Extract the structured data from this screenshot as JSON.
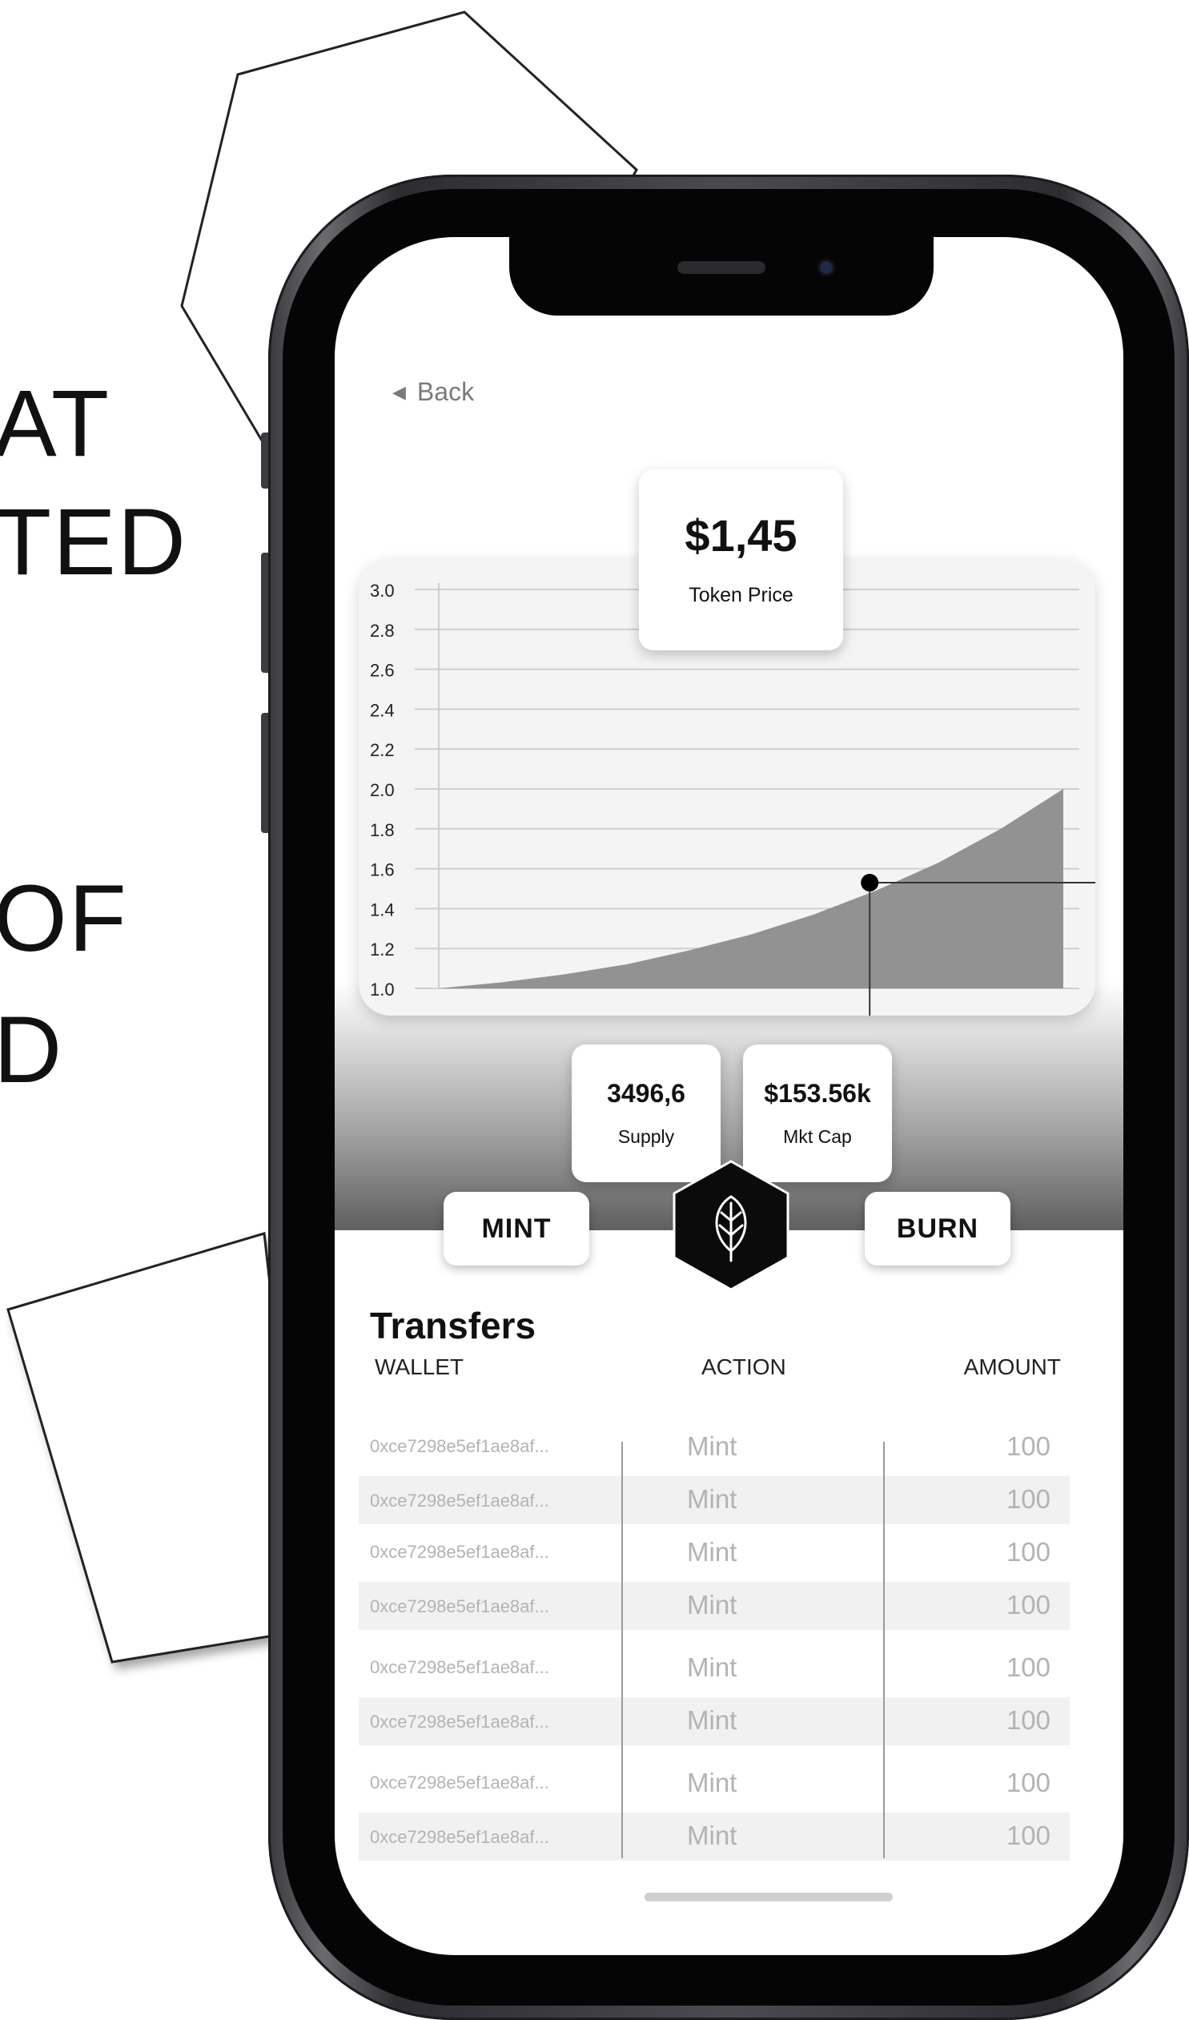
{
  "background": {
    "text_lines": [
      "AT",
      "TED",
      "OF",
      "D"
    ]
  },
  "screen": {
    "back_label": "Back",
    "token": {
      "price": "$1,45",
      "price_label": "Token Price"
    },
    "stats": [
      {
        "value": "3496,6",
        "label": "Supply"
      },
      {
        "value": "$153.56k",
        "label": "Mkt Cap"
      }
    ],
    "actions": {
      "mint": "MINT",
      "burn": "BURN",
      "logo_icon": "leaf-icon"
    },
    "transfers": {
      "title": "Transfers",
      "headers": {
        "wallet": "WALLET",
        "action": "ACTION",
        "amount": "AMOUNT"
      },
      "rows": [
        {
          "wallet": "0xce7298e5ef1ae8af...",
          "action": "Mint",
          "amount": "100"
        },
        {
          "wallet": "0xce7298e5ef1ae8af...",
          "action": "Mint",
          "amount": "100"
        },
        {
          "wallet": "0xce7298e5ef1ae8af...",
          "action": "Mint",
          "amount": "100"
        },
        {
          "wallet": "0xce7298e5ef1ae8af...",
          "action": "Mint",
          "amount": "100"
        },
        {
          "wallet": "0xce7298e5ef1ae8af...",
          "action": "Mint",
          "amount": "100"
        },
        {
          "wallet": "0xce7298e5ef1ae8af...",
          "action": "Mint",
          "amount": "100"
        },
        {
          "wallet": "0xce7298e5ef1ae8af...",
          "action": "Mint",
          "amount": "100"
        },
        {
          "wallet": "0xce7298e5ef1ae8af...",
          "action": "Mint",
          "amount": "100"
        }
      ]
    }
  },
  "chart_data": {
    "type": "area",
    "title": "",
    "xlabel": "",
    "ylabel": "",
    "ylim": [
      1.0,
      3.0
    ],
    "yticks": [
      "3.0",
      "2.8",
      "2.6",
      "2.4",
      "2.2",
      "2.0",
      "1.8",
      "1.6",
      "1.4",
      "1.2",
      "1.0"
    ],
    "ytick_values": [
      3.0,
      2.8,
      2.6,
      2.4,
      2.2,
      2.0,
      1.8,
      1.6,
      1.4,
      1.2,
      1.0
    ],
    "x": [
      0,
      0.1,
      0.2,
      0.3,
      0.4,
      0.5,
      0.6,
      0.7,
      0.8,
      0.9,
      1.0
    ],
    "series": [
      {
        "values": [
          1.0,
          1.03,
          1.07,
          1.12,
          1.19,
          1.27,
          1.37,
          1.49,
          1.63,
          1.8,
          2.0
        ]
      }
    ],
    "marker": {
      "x": 0.69,
      "y": 1.53
    },
    "grid": true,
    "color": "#8c8c8c"
  }
}
